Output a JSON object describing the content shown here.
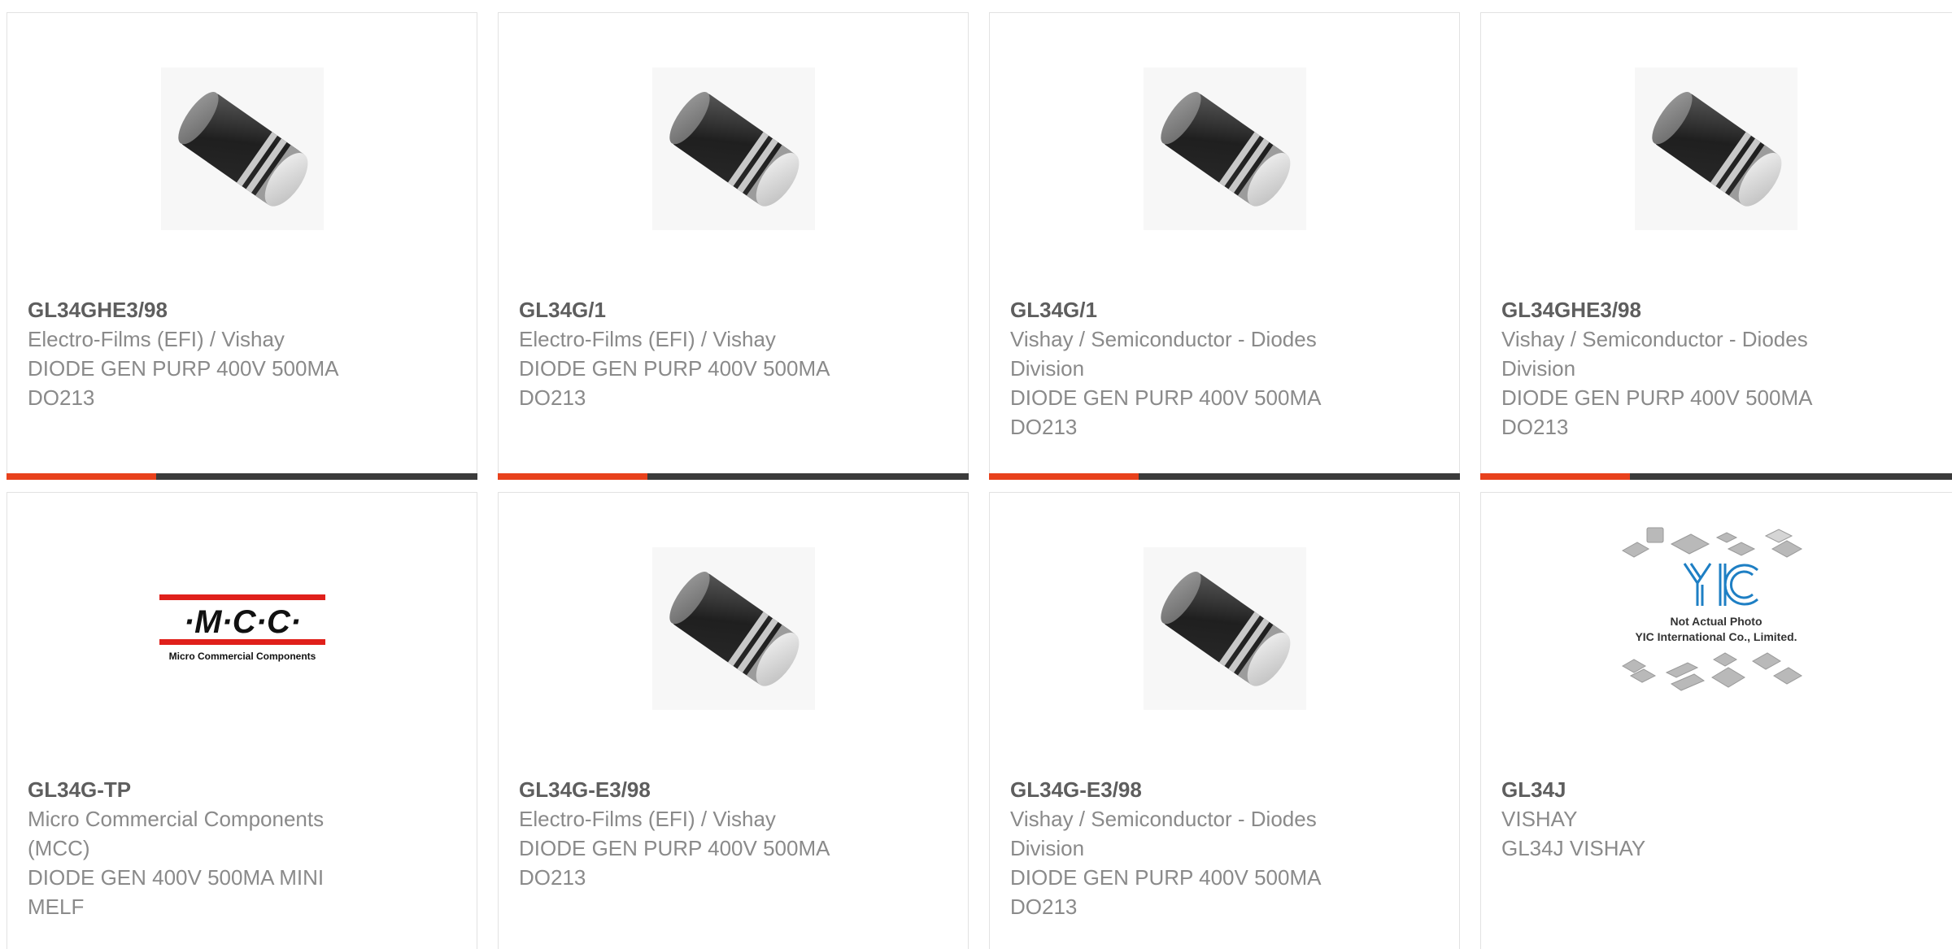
{
  "products": [
    {
      "part_number": "GL34GHE3/98",
      "manufacturer": "Electro-Films (EFI) / Vishay",
      "description": "DIODE GEN PURP 400V 500MA DO213",
      "image": "diode-melf-icon"
    },
    {
      "part_number": "GL34G/1",
      "manufacturer": "Electro-Films (EFI) / Vishay",
      "description": "DIODE GEN PURP 400V 500MA DO213",
      "image": "diode-melf-icon"
    },
    {
      "part_number": "GL34G/1",
      "manufacturer": "Vishay / Semiconductor - Diodes Division",
      "description": "DIODE GEN PURP 400V 500MA DO213",
      "image": "diode-melf-icon"
    },
    {
      "part_number": "GL34GHE3/98",
      "manufacturer": "Vishay / Semiconductor - Diodes Division",
      "description": "DIODE GEN PURP 400V 500MA DO213",
      "image": "diode-melf-icon"
    },
    {
      "part_number": "GL34G-TP",
      "manufacturer": "Micro Commercial Components (MCC)",
      "description": "DIODE GEN 400V 500MA MINI MELF",
      "image": "mcc-logo",
      "logo_text": "·M·C·C·",
      "logo_subtext": "Micro Commercial Components"
    },
    {
      "part_number": "GL34G-E3/98",
      "manufacturer": "Electro-Films (EFI) / Vishay",
      "description": "DIODE GEN PURP 400V 500MA DO213",
      "image": "diode-melf-icon"
    },
    {
      "part_number": "GL34G-E3/98",
      "manufacturer": "Vishay / Semiconductor - Diodes Division",
      "description": "DIODE GEN PURP 400V 500MA DO213",
      "image": "diode-melf-icon"
    },
    {
      "part_number": "GL34J",
      "manufacturer": "VISHAY",
      "description": "GL34J VISHAY",
      "image": "yic-placeholder",
      "placeholder_logo": "YIC",
      "placeholder_line1": "Not Actual Photo",
      "placeholder_line2": "YIC International Co., Limited."
    }
  ],
  "colors": {
    "accent": "#e8411c",
    "bar": "#3b3b3b",
    "border": "#e2e2e2",
    "text": "#8a8a8a",
    "title": "#5e5e5e",
    "mcc_red": "#e0201b",
    "yic_blue": "#1e7fc4"
  }
}
